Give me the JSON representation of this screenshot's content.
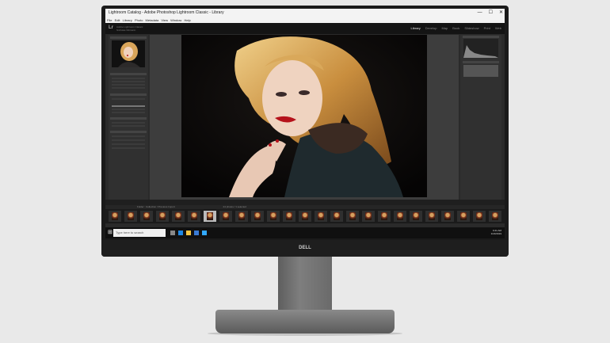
{
  "window": {
    "title": "Lightroom Catalog - Adobe Photoshop Lightroom Classic - Library",
    "controls": [
      "—",
      "☐",
      "✕"
    ]
  },
  "menu": [
    "File",
    "Edit",
    "Library",
    "Photo",
    "Metadata",
    "View",
    "Window",
    "Help"
  ],
  "identity": {
    "logo": "Lr",
    "line1": "Adobe Lightroom Classic",
    "line2": "Nicholas Nittmann"
  },
  "modules": [
    {
      "label": "Library",
      "active": true
    },
    {
      "label": "Develop",
      "active": false
    },
    {
      "label": "Map",
      "active": false
    },
    {
      "label": "Book",
      "active": false
    },
    {
      "label": "Slideshow",
      "active": false
    },
    {
      "label": "Print",
      "active": false
    },
    {
      "label": "Web",
      "active": false
    }
  ],
  "left_panel": {
    "navigator": "Navigator",
    "sections": [
      "Catalog",
      "Folders",
      "Collections",
      "Publish Services"
    ]
  },
  "right_panel": {
    "histogram": "Histogram",
    "quick_develop": "Quick Develop"
  },
  "filmstrip": {
    "path": "Folder : Collection / Previous Import",
    "count": "24 photos / 1 selected"
  },
  "taskbar": {
    "search_placeholder": "Type here to search",
    "time": "9:41 AM",
    "date": "1/23/2019"
  },
  "monitor": {
    "brand": "DELL"
  },
  "colors": {
    "accent": "#e0e0e0",
    "bezel": "#1a1a1a",
    "panel": "#303030"
  }
}
